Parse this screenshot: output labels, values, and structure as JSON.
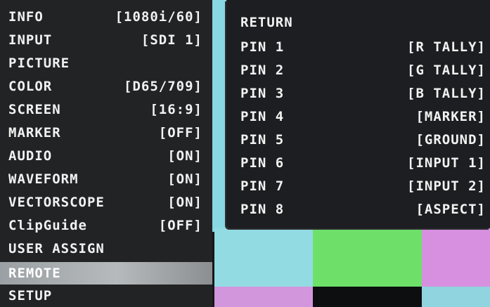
{
  "menu": {
    "items": [
      {
        "label": "INFO",
        "value": "[1080i/60]"
      },
      {
        "label": "INPUT",
        "value": "[SDI 1]"
      },
      {
        "label": "PICTURE",
        "value": ""
      },
      {
        "label": "COLOR",
        "value": "[D65/709]"
      },
      {
        "label": "SCREEN",
        "value": "[16:9]"
      },
      {
        "label": "MARKER",
        "value": "[OFF]"
      },
      {
        "label": "AUDIO",
        "value": "[ON]"
      },
      {
        "label": "WAVEFORM",
        "value": "[ON]"
      },
      {
        "label": "VECTORSCOPE",
        "value": "[ON]"
      },
      {
        "label": "ClipGuide",
        "value": "[OFF]"
      },
      {
        "label": "USER ASSIGN",
        "value": ""
      },
      {
        "label": "REMOTE",
        "value": ""
      },
      {
        "label": "SETUP",
        "value": ""
      }
    ],
    "selected": "REMOTE"
  },
  "submenu": {
    "items": [
      {
        "label": "RETURN",
        "value": ""
      },
      {
        "label": "PIN 1",
        "value": "[R TALLY]"
      },
      {
        "label": "PIN 2",
        "value": "[G TALLY]"
      },
      {
        "label": "PIN 3",
        "value": "[B TALLY]"
      },
      {
        "label": "PIN 4",
        "value": "[MARKER]"
      },
      {
        "label": "PIN 5",
        "value": "[GROUND]"
      },
      {
        "label": "PIN 6",
        "value": "[INPUT 1]"
      },
      {
        "label": "PIN 7",
        "value": "[INPUT 2]"
      },
      {
        "label": "PIN 8",
        "value": "[ASPECT]"
      }
    ]
  },
  "colors": {
    "menu_bg": "#222325",
    "highlight": "#b6babc",
    "text": "#f2f2f2",
    "bar_cyan": "#92dbe3",
    "bar_green": "#6ee06a",
    "bar_magenta": "#d690df"
  }
}
